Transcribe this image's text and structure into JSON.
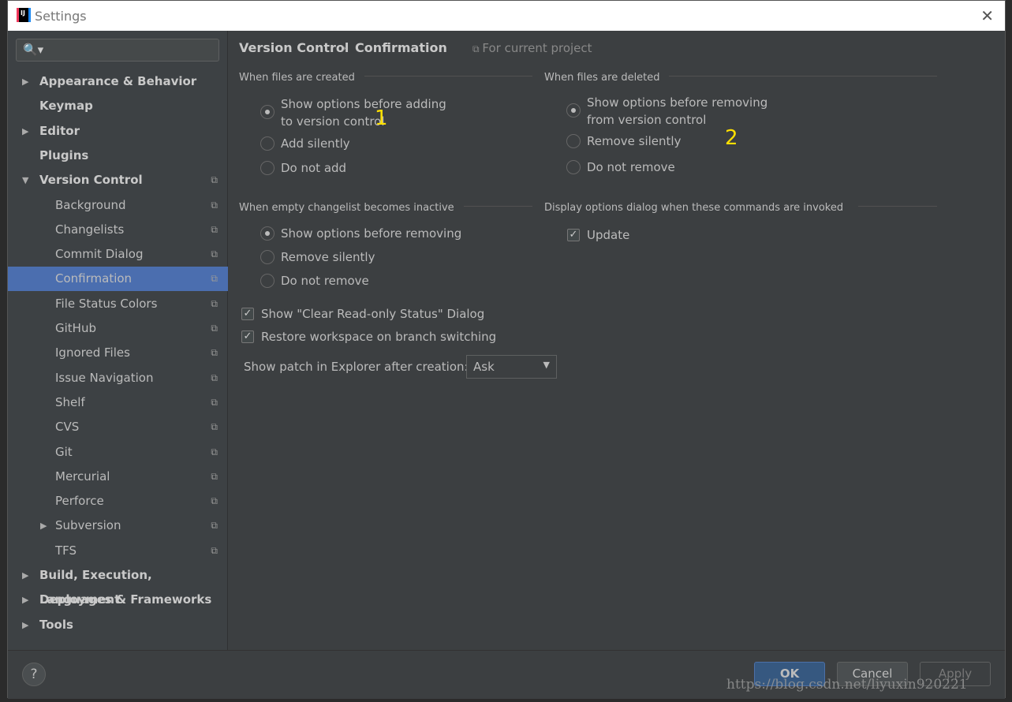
{
  "window": {
    "title": "Settings",
    "close": "✕"
  },
  "search": {
    "icon": "🔍▾"
  },
  "sidebar": {
    "items": [
      {
        "label": "Appearance & Behavior",
        "bold": true,
        "arrow": "▶"
      },
      {
        "label": "Keymap",
        "bold": true
      },
      {
        "label": "Editor",
        "bold": true,
        "arrow": "▶"
      },
      {
        "label": "Plugins",
        "bold": true
      },
      {
        "label": "Version Control",
        "bold": true,
        "arrow": "▼",
        "copy": true
      },
      {
        "label": "Background",
        "copy": true
      },
      {
        "label": "Changelists",
        "copy": true
      },
      {
        "label": "Commit Dialog",
        "copy": true
      },
      {
        "label": "Confirmation",
        "copy": true,
        "selected": true
      },
      {
        "label": "File Status Colors",
        "copy": true
      },
      {
        "label": "GitHub",
        "copy": true
      },
      {
        "label": "Ignored Files",
        "copy": true
      },
      {
        "label": "Issue Navigation",
        "copy": true
      },
      {
        "label": "Shelf",
        "copy": true
      },
      {
        "label": "CVS",
        "copy": true
      },
      {
        "label": "Git",
        "copy": true
      },
      {
        "label": "Mercurial",
        "copy": true
      },
      {
        "label": "Perforce",
        "copy": true
      },
      {
        "label": "Subversion",
        "copy": true,
        "arrow": "▶"
      },
      {
        "label": "TFS",
        "copy": true
      },
      {
        "label": "Build, Execution, Deployment",
        "bold": true,
        "arrow": "▶"
      },
      {
        "label": "Languages & Frameworks",
        "bold": true,
        "arrow": "▶"
      },
      {
        "label": "Tools",
        "bold": true,
        "arrow": "▶"
      }
    ]
  },
  "main": {
    "breadcrumb": [
      "Version Control",
      "›",
      "Confirmation"
    ],
    "scope": "For current project",
    "created": {
      "title": "When files are created",
      "opts": [
        "Show options before adding",
        "to version control",
        "Add silently",
        "Do not add"
      ],
      "selected": 0
    },
    "deleted": {
      "title": "When files are deleted",
      "opts": [
        "Show options before removing",
        "from version control",
        "Remove silently",
        "Do not remove"
      ],
      "selected": 0
    },
    "empty": {
      "title": "When empty changelist becomes inactive",
      "opts": [
        "Show options before removing",
        "Remove silently",
        "Do not remove"
      ],
      "selected": 0
    },
    "display": {
      "title": "Display options dialog when these commands are invoked",
      "update": "Update",
      "update_checked": true
    },
    "clear_ro": "Show \"Clear Read-only Status\" Dialog",
    "restore": "Restore workspace on branch switching",
    "patch_label": "Show patch in Explorer after creation:",
    "patch_value": "Ask",
    "annotations": [
      "1",
      "2"
    ]
  },
  "footer": {
    "help": "?",
    "ok": "OK",
    "cancel": "Cancel",
    "apply": "Apply",
    "watermark": "https://blog.csdn.net/liyuxin920221"
  },
  "colors": {
    "accent": "#4b6eaf",
    "ok": "#365880",
    "annotation": "#ffe000"
  }
}
